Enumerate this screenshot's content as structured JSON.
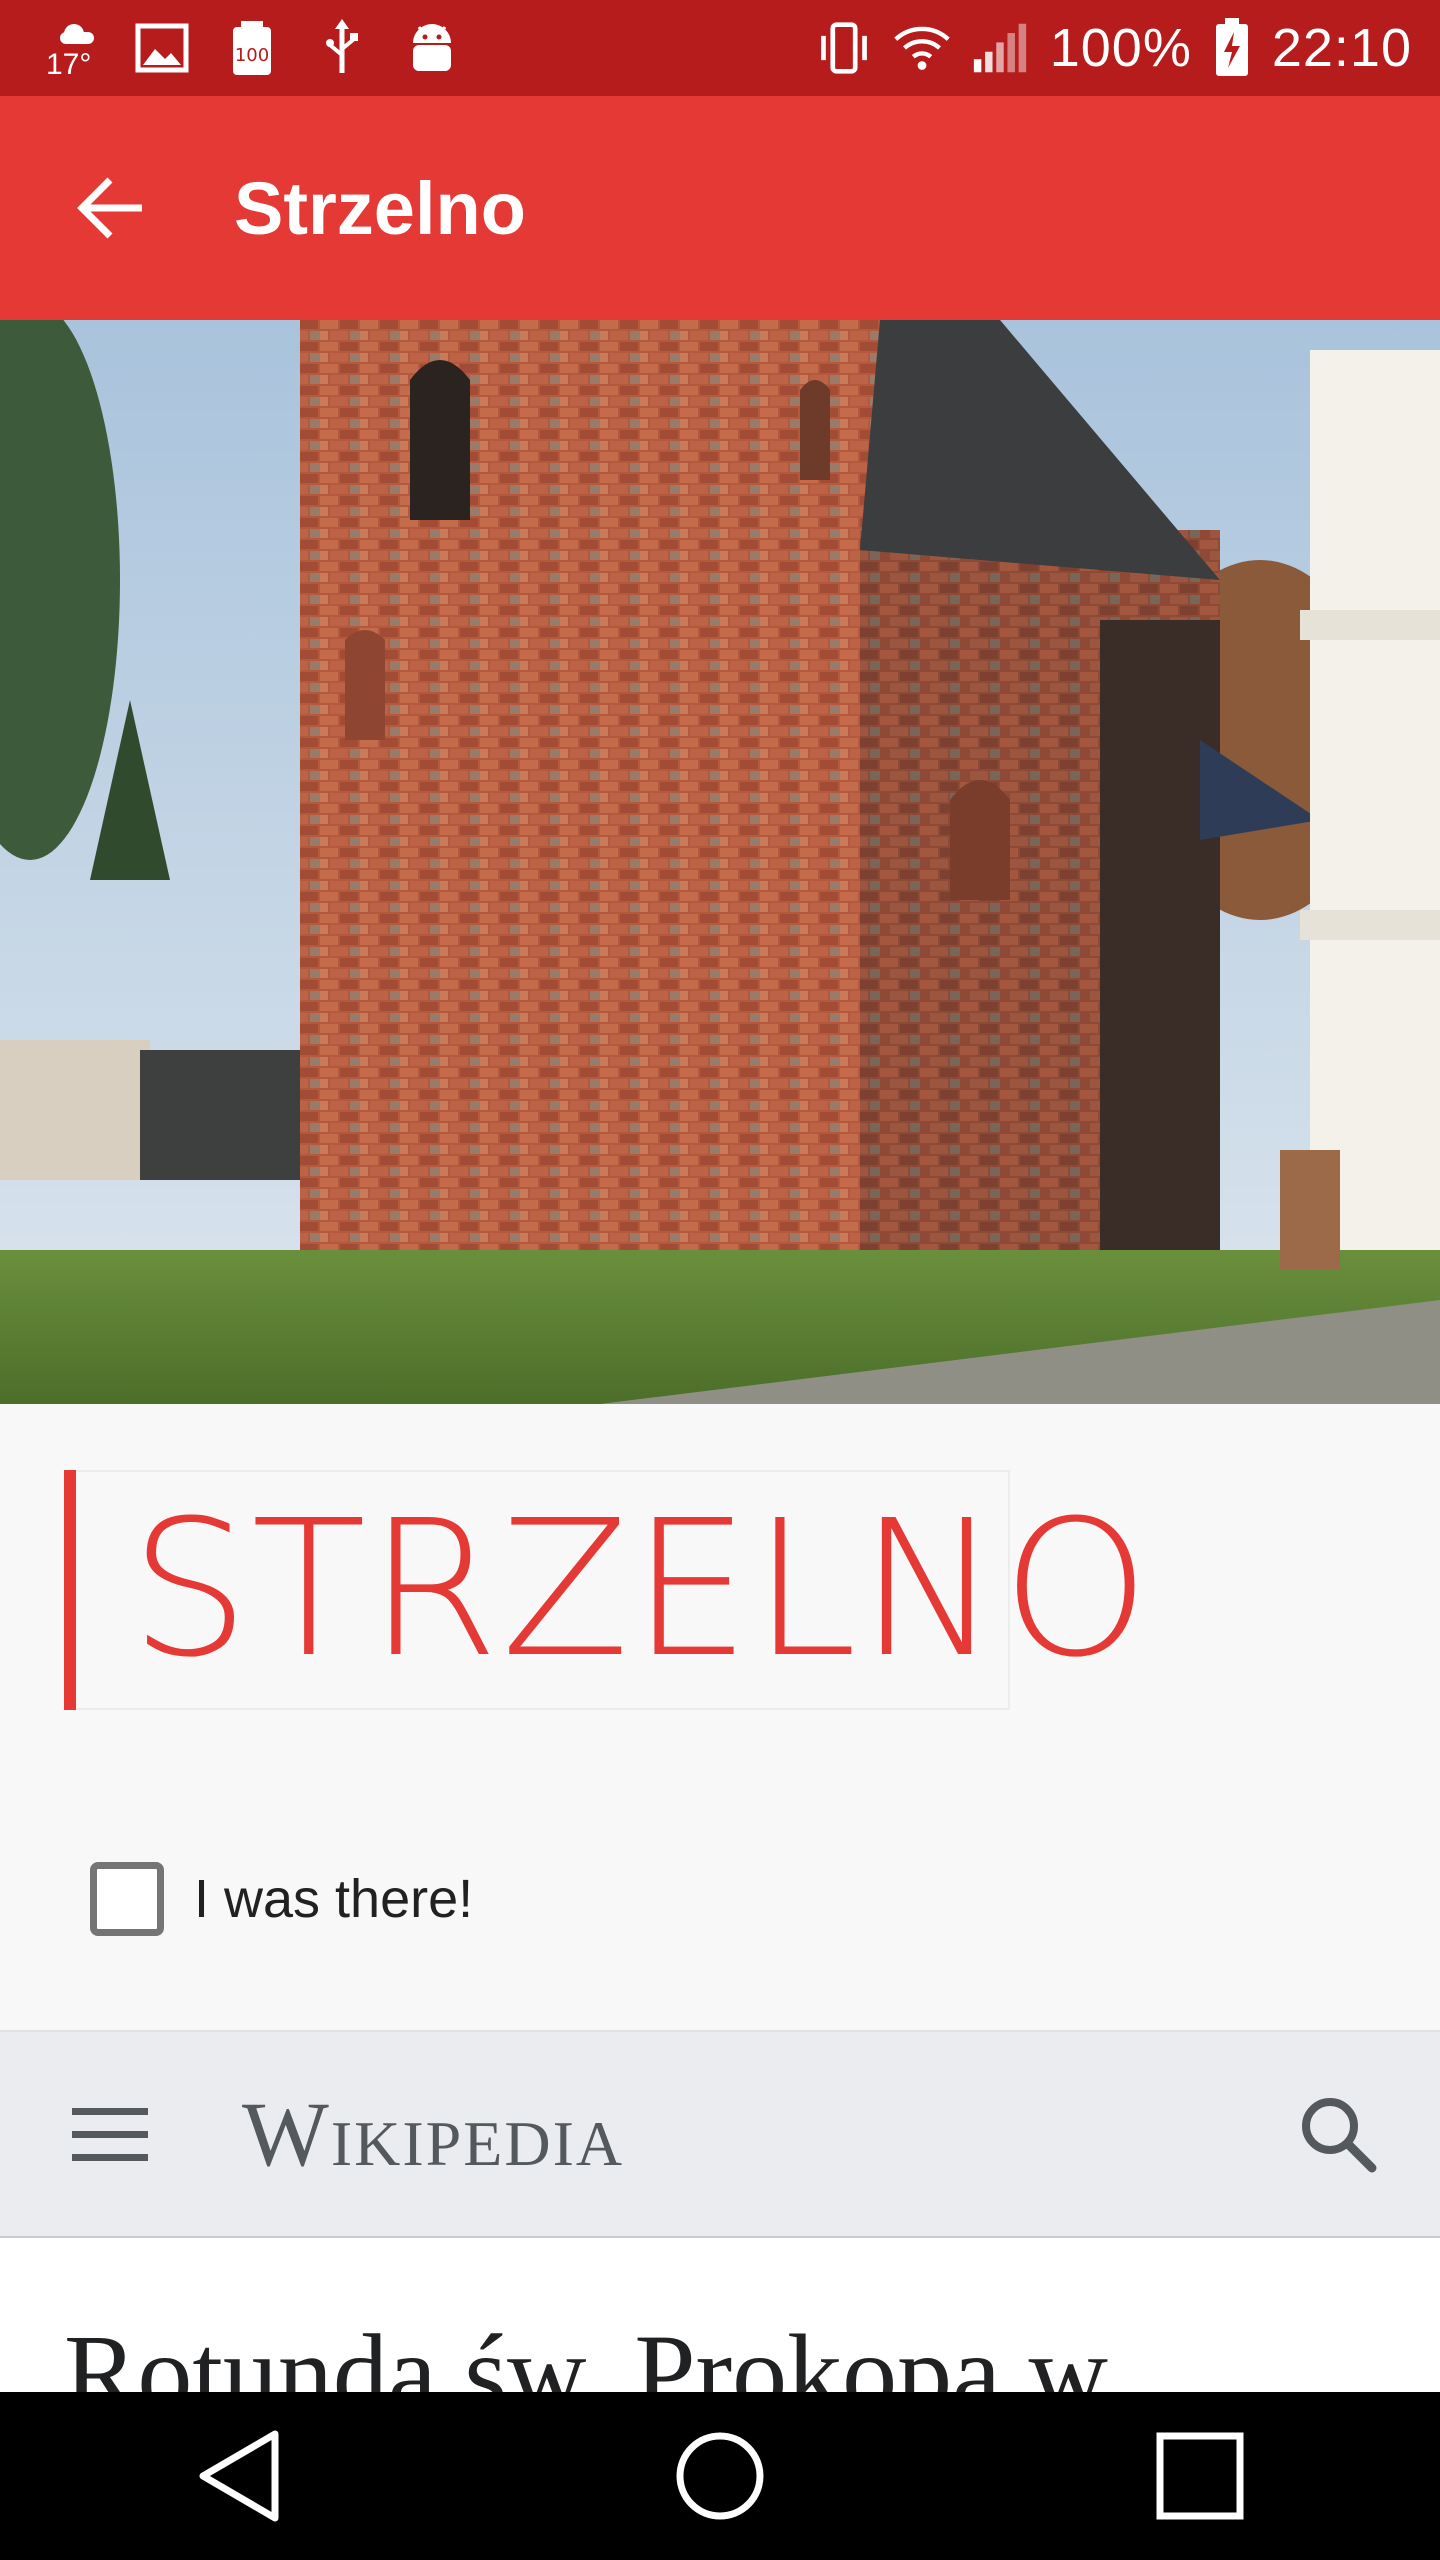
{
  "status_bar": {
    "temperature": "17°",
    "battery_percent": "100%",
    "time": "22:10",
    "left_icons": [
      "weather-icon",
      "image-icon",
      "storage-100-icon",
      "usb-icon",
      "android-debug-icon"
    ],
    "right_icons": [
      "vibrate-icon",
      "wifi-icon",
      "signal-icon",
      "battery-charging-icon"
    ]
  },
  "app_bar": {
    "title": "Strzelno",
    "back_icon": "arrow-left-icon"
  },
  "hero": {
    "description_icon": "photo"
  },
  "place": {
    "title": "STRZELNO",
    "accent_color": "#e53935"
  },
  "checkbox": {
    "label": "I was there!",
    "checked": false
  },
  "wiki_header": {
    "logo": "Wikipedia",
    "menu_icon": "hamburger-menu-icon",
    "search_icon": "search-icon"
  },
  "article": {
    "heading": "Rotunda św. Prokopa w"
  },
  "nav": {
    "back_icon": "nav-back-icon",
    "home_icon": "nav-home-icon",
    "recents_icon": "nav-recents-icon"
  }
}
